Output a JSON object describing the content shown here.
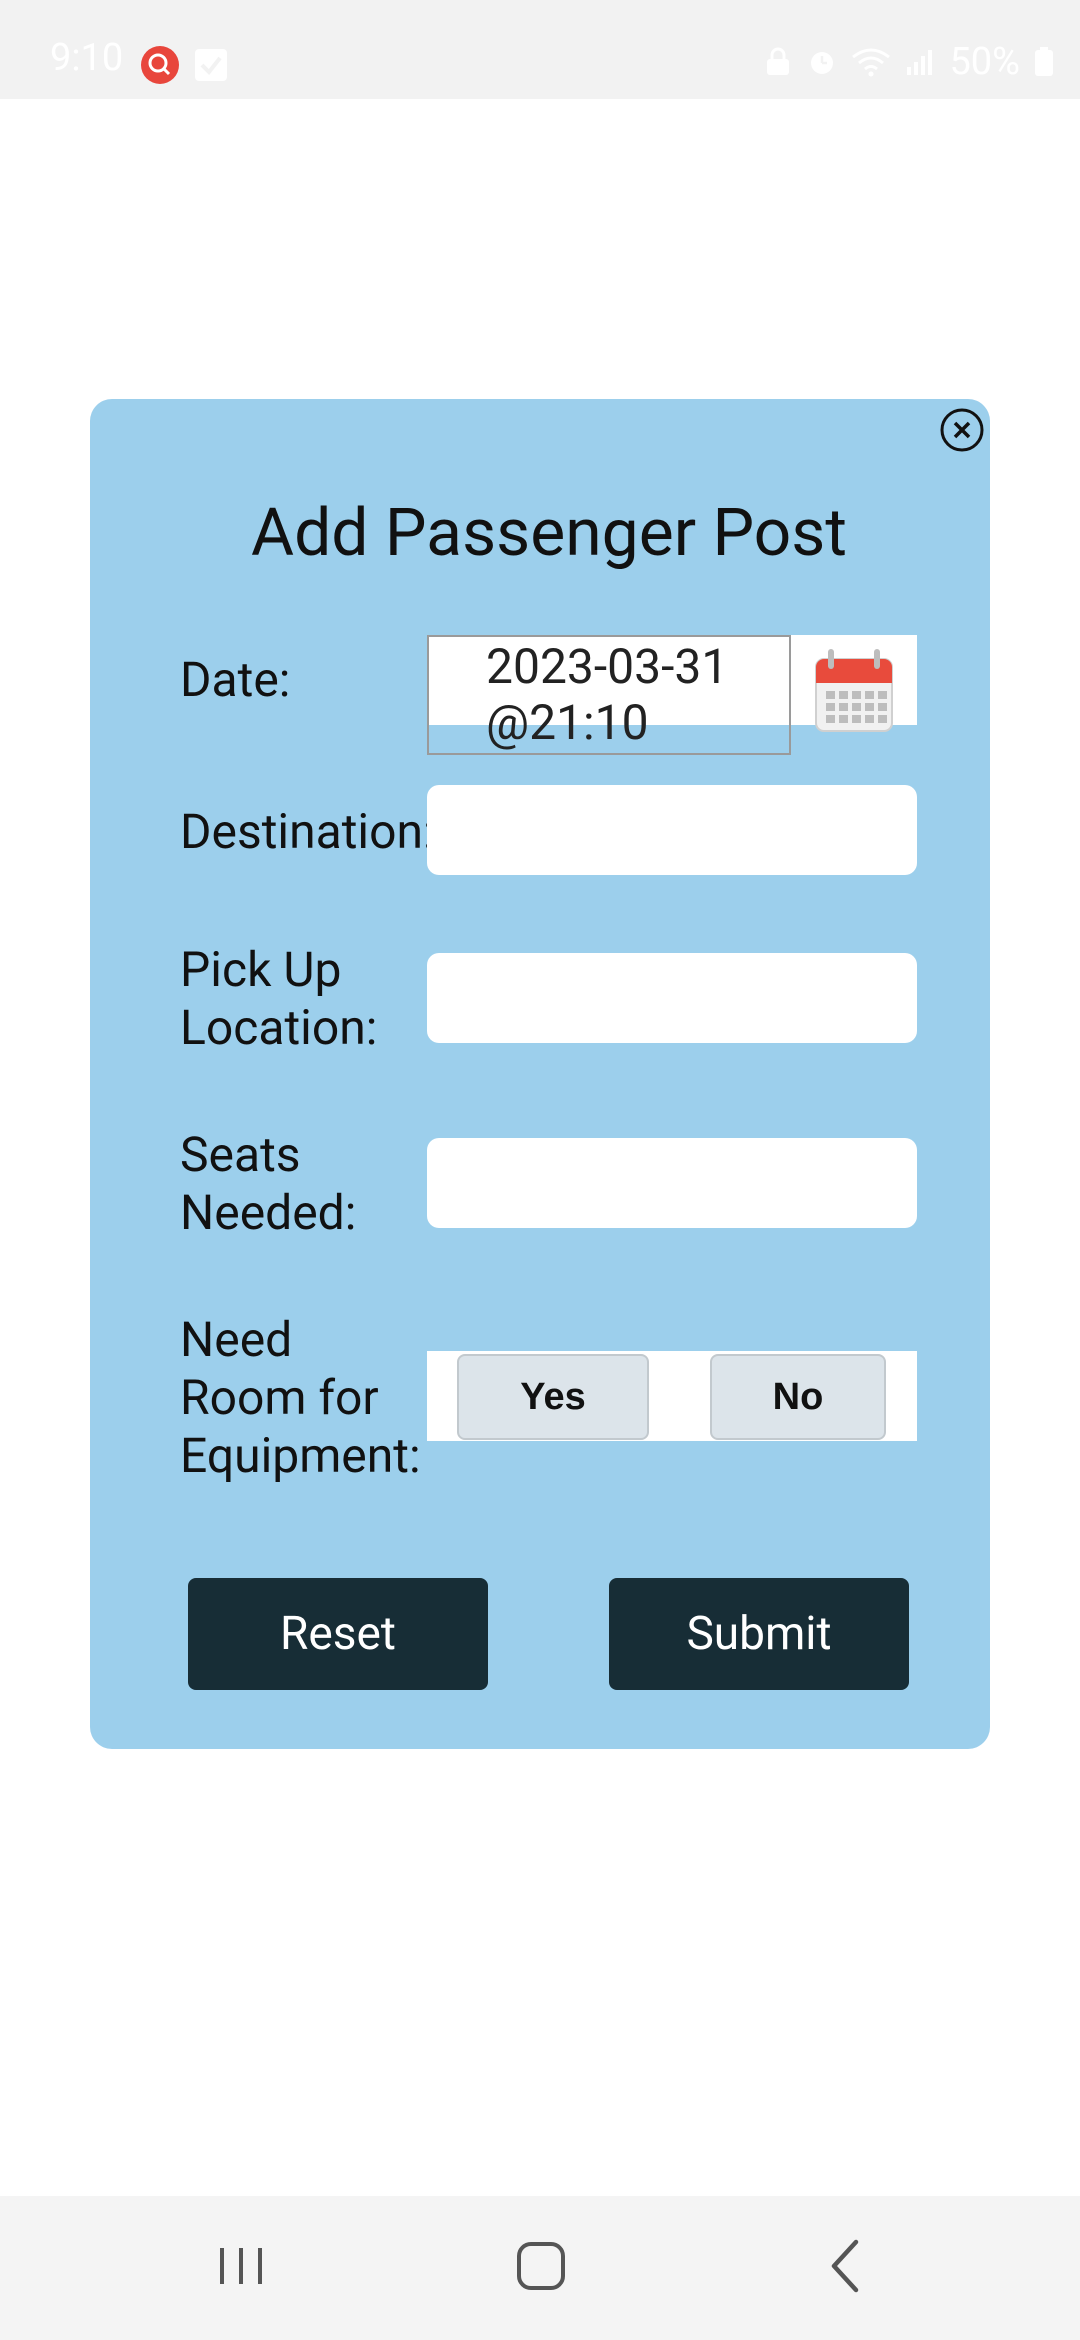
{
  "status_bar": {
    "time": "9:10",
    "battery": "50%"
  },
  "modal": {
    "title": "Add Passenger Post",
    "fields": {
      "date": {
        "label": "Date:",
        "value_line1": "2023-03-31",
        "value_line2": "@21:10"
      },
      "destination": {
        "label": "Destination:",
        "value": ""
      },
      "pickup": {
        "label_line1": "Pick Up",
        "label_line2": "Location:",
        "value": ""
      },
      "seats": {
        "label_line1": "Seats",
        "label_line2": "Needed:",
        "value": ""
      },
      "equipment": {
        "label_line1": "Need",
        "label_line2": "Room for",
        "label_line3": "Equipment:",
        "yes_label": "Yes",
        "no_label": "No"
      }
    },
    "buttons": {
      "reset": "Reset",
      "submit": "Submit"
    }
  },
  "colors": {
    "modal_bg": "#9ccfec",
    "button_dark": "#172d36",
    "choice_bg": "#dce4ea",
    "status_icon_red": "#e8463c"
  },
  "icons": {
    "close": "close-icon",
    "calendar": "calendar-icon",
    "nav_recents": "recents-icon",
    "nav_home": "home-icon",
    "nav_back": "back-icon"
  }
}
